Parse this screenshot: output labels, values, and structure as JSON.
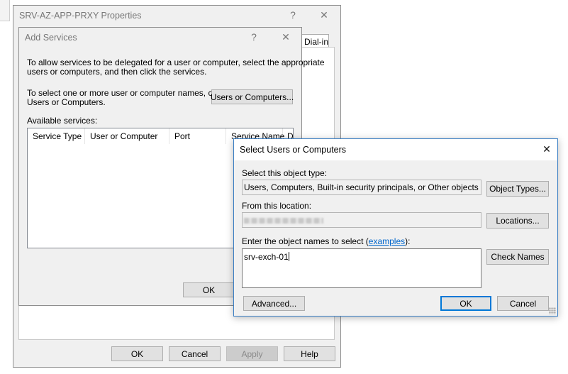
{
  "properties_window": {
    "title": "SRV-AZ-APP-PRXY Properties",
    "help_icon": "?",
    "close_icon": "✕",
    "tab_dialin": "Dial-in",
    "ok_label": "OK",
    "cancel_label": "Cancel",
    "apply_label": "Apply",
    "help_label": "Help"
  },
  "add_services": {
    "title": "Add Services",
    "help_icon": "?",
    "close_icon": "✕",
    "intro_line1": "To allow services to be delegated for a user or computer, select the appropriate",
    "intro_line2": "users or computers, and then click the services.",
    "select_line1": "To select one or more user or computer names, click",
    "select_line2": "Users or Computers.",
    "users_computers_button": "Users or Computers...",
    "available_label": "Available services:",
    "columns": [
      "Service Type",
      "User or Computer",
      "Port",
      "Service Name",
      "D"
    ],
    "ok_label": "OK"
  },
  "select_users": {
    "title": "Select Users or Computers",
    "close_icon": "✕",
    "object_type_label": "Select this object type:",
    "object_type_value": "Users, Computers, Built-in security principals, or Other objects",
    "object_types_button": "Object Types...",
    "location_label": "From this location:",
    "location_value": "",
    "locations_button": "Locations...",
    "names_label_prefix": "Enter the object names to select (",
    "names_label_link": "examples",
    "names_label_suffix": "):",
    "names_value": "srv-exch-01",
    "check_names_button": "Check Names",
    "advanced_button": "Advanced...",
    "ok_label": "OK",
    "cancel_label": "Cancel"
  },
  "colors": {
    "window_bg": "#f0f0f0",
    "border": "#8e8e8e",
    "focus_blue": "#0078d7",
    "link_blue": "#0066cc"
  }
}
